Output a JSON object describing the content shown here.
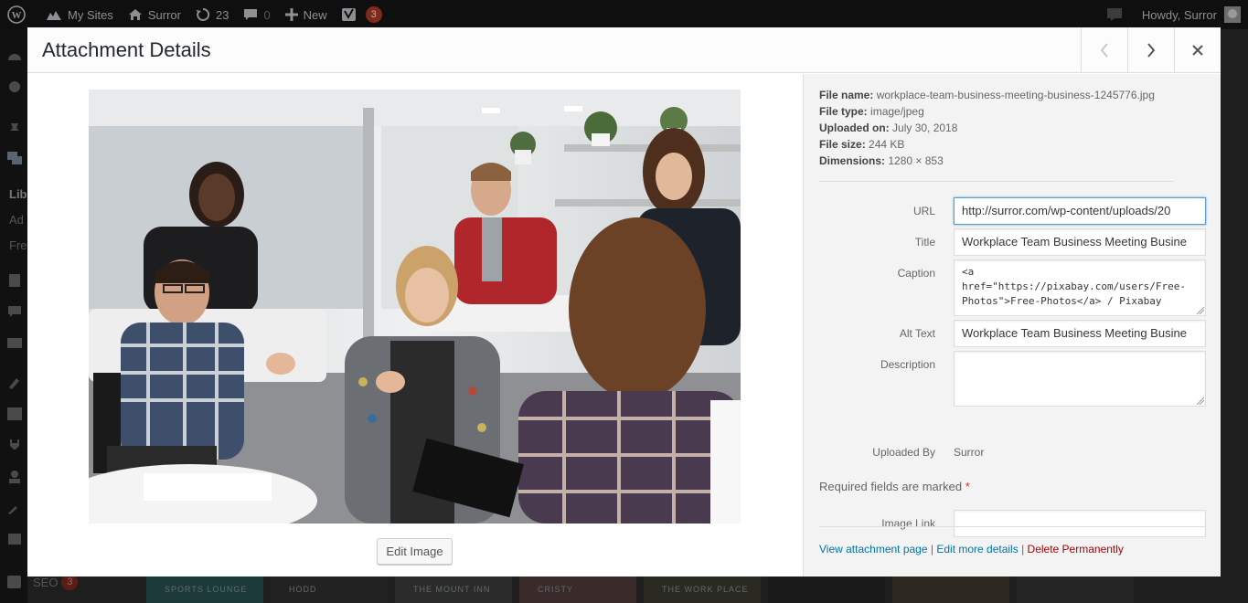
{
  "admin_bar": {
    "my_sites": "My Sites",
    "site_name": "Surror",
    "updates_count": "23",
    "comments_count": "0",
    "new_label": "New",
    "yoast_count": "3",
    "howdy": "Howdy, Surror"
  },
  "sidebar_bg": {
    "library": "Lib",
    "add": "Ad",
    "free": "Fre",
    "seo": "SEO",
    "seo_count": "3"
  },
  "background_tiles": [
    "SPORTS LOUNGE",
    "HODD",
    "THE MOUNT INN",
    "CRISTY",
    "THE WORK PLACE"
  ],
  "modal": {
    "title": "Attachment Details",
    "edit_image_label": "Edit Image"
  },
  "file_info": {
    "file_name_label": "File name:",
    "file_name": "workplace-team-business-meeting-business-1245776.jpg",
    "file_type_label": "File type:",
    "file_type": "image/jpeg",
    "uploaded_on_label": "Uploaded on:",
    "uploaded_on": "July 30, 2018",
    "file_size_label": "File size:",
    "file_size": "244 KB",
    "dimensions_label": "Dimensions:",
    "dimensions": "1280 × 853"
  },
  "fields": {
    "url_label": "URL",
    "url_value": "http://surror.com/wp-content/uploads/20",
    "title_label": "Title",
    "title_value": "Workplace Team Business Meeting Busine",
    "caption_label": "Caption",
    "caption_value": "<a href=\"https://pixabay.com/users/Free-Photos\">Free-Photos</a> / Pixabay",
    "alt_label": "Alt Text",
    "alt_value": "Workplace Team Business Meeting Busine",
    "description_label": "Description",
    "description_value": "",
    "uploaded_by_label": "Uploaded By",
    "uploaded_by_value": "Surror",
    "required_note": "Required fields are marked",
    "required_star": "*",
    "image_link_label": "Image Link",
    "image_link_value": ""
  },
  "actions": {
    "view_attachment": "View attachment page",
    "edit_more": "Edit more details",
    "delete": "Delete Permanently",
    "separator": "|"
  },
  "colors": {
    "link": "#0073aa",
    "danger": "#a00000",
    "focus_border": "#5b9dd9",
    "yoast_badge": "#7f2a1d"
  }
}
